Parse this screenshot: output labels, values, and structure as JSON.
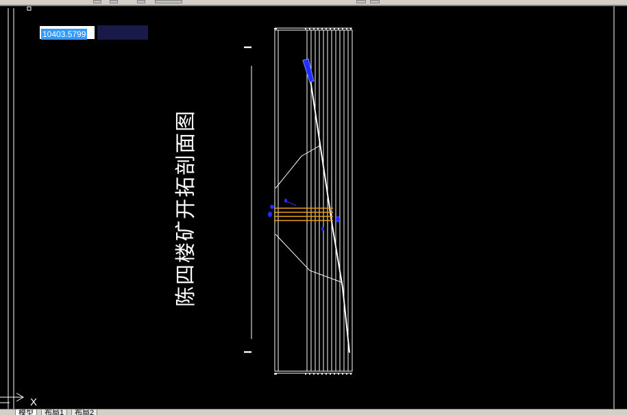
{
  "app": {
    "coordinate_input": "10403.5799"
  },
  "drawing": {
    "title": "陈四楼矿开拓剖面图",
    "section_mark_top": "I",
    "section_mark_bottom": "I",
    "ucs_axis_label": "X"
  },
  "colors": {
    "background": "#000000",
    "lines": "#ffffff",
    "seam": "#e8a020",
    "markers": "#1f2fff"
  },
  "layout_tabs": [
    {
      "label": "模型",
      "active": true
    },
    {
      "label": "布局1",
      "active": false
    },
    {
      "label": "布局2",
      "active": false
    }
  ]
}
